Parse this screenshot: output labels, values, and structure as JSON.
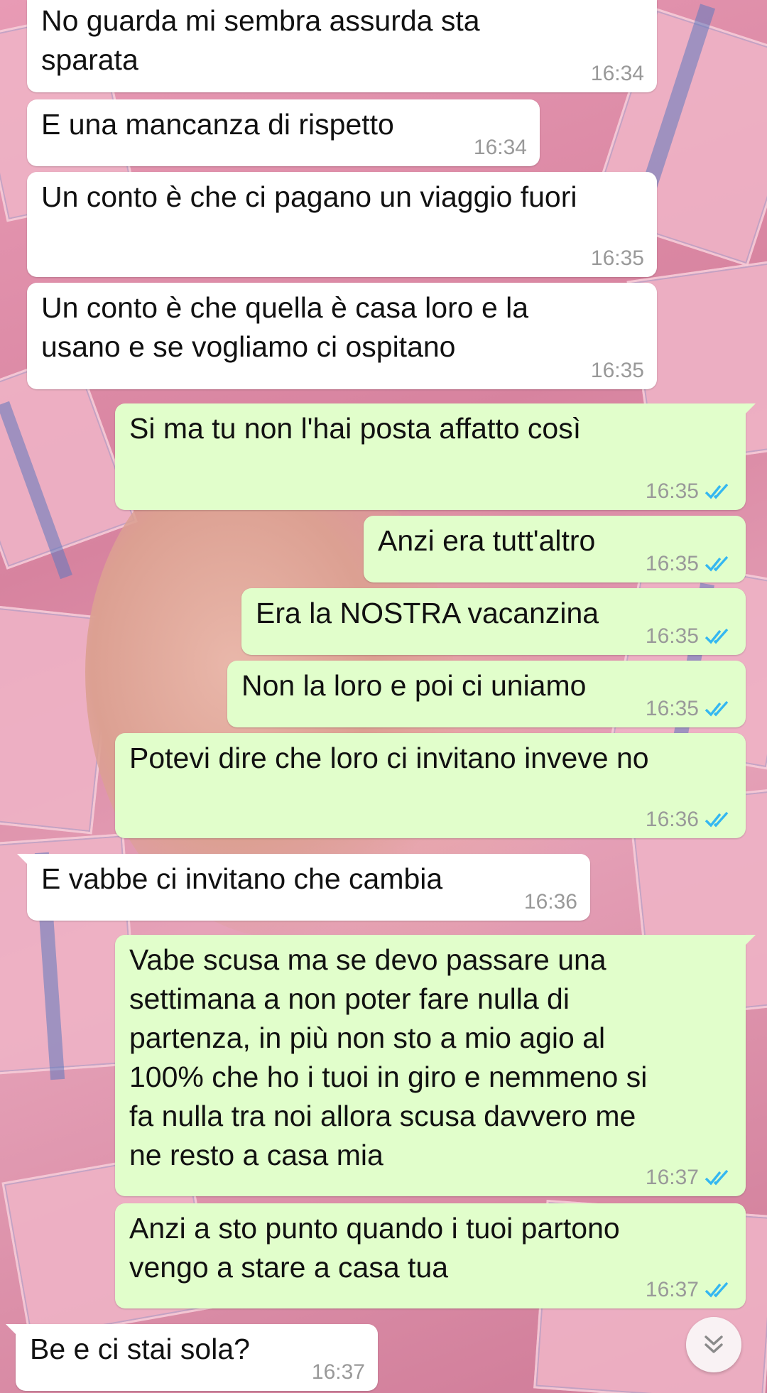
{
  "messages": [
    {
      "direction": "in",
      "text": "No guarda mi sembra assurda sta\nsparata",
      "time": "16:34"
    },
    {
      "direction": "in",
      "text": "E una mancanza di rispetto",
      "time": "16:34"
    },
    {
      "direction": "in",
      "text": "Un conto è che ci pagano un viaggio fuori",
      "time": "16:35"
    },
    {
      "direction": "in",
      "text": "Un conto è che quella è casa loro e la\nusano e se vogliamo ci ospitano",
      "time": "16:35"
    },
    {
      "direction": "out",
      "text": "Si ma tu non l'hai posta affatto così",
      "time": "16:35",
      "status": "read"
    },
    {
      "direction": "out",
      "text": "Anzi era tutt'altro",
      "time": "16:35",
      "status": "read"
    },
    {
      "direction": "out",
      "text": "Era la NOSTRA vacanzina",
      "time": "16:35",
      "status": "read"
    },
    {
      "direction": "out",
      "text": "Non la loro e poi ci uniamo",
      "time": "16:35",
      "status": "read"
    },
    {
      "direction": "out",
      "text": "Potevi dire che loro ci invitano inveve no",
      "time": "16:36",
      "status": "read"
    },
    {
      "direction": "in",
      "text": "E vabbe ci invitano che cambia",
      "time": "16:36"
    },
    {
      "direction": "out",
      "text": "Vabe scusa ma se devo passare una\nsettimana a non poter fare nulla di\npartenza, in più non sto a mio agio al\n100% che ho i tuoi in giro e nemmeno si\nfa nulla tra noi allora scusa davvero me\nne resto a casa mia",
      "time": "16:37",
      "status": "read"
    },
    {
      "direction": "out",
      "text": "Anzi a sto punto quando i tuoi partono\nvengo a stare a casa tua",
      "time": "16:37",
      "status": "read"
    },
    {
      "direction": "in",
      "text": "Be e ci stai sola?",
      "time": "16:37"
    }
  ],
  "colors": {
    "incoming_bubble": "#ffffff",
    "outgoing_bubble": "#e1fecb",
    "read_ticks": "#34b7f1",
    "timestamp": "#999999"
  },
  "icons": {
    "read_receipt": "double-check-icon",
    "scroll_down": "chevron-double-down-icon"
  }
}
